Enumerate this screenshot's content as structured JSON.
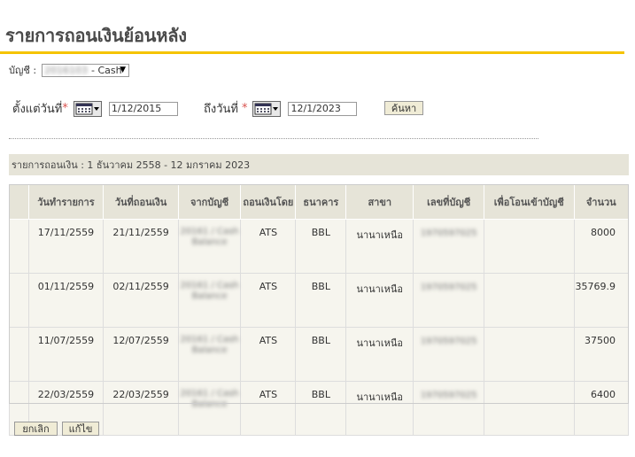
{
  "page": {
    "title": "รายการถอนเงินย้อนหลัง"
  },
  "account": {
    "label": "บัญชี :",
    "selected_number": "2016103",
    "selected_suffix": "- Cash"
  },
  "filter": {
    "from_label": "ตั้งแต่วันที่",
    "to_label": "ถึงวันที่",
    "required_mark": "*",
    "from_value": "1/12/2015",
    "to_value": "12/1/2023",
    "search_label": "ค้นหา"
  },
  "period": {
    "text": "รายการถอนเงิน : 1 ธันวาคม 2558 - 12 มกราคม 2023"
  },
  "table": {
    "columns": [
      "วันทำรายการ",
      "วันที่ถอนเงิน",
      "จากบัญชี",
      "ถอนเงินโดย",
      "ธนาคาร",
      "สาขา",
      "เลขที่บัญชี",
      "เพื่อโอนเข้าบัญชี",
      "จำนวน"
    ],
    "rows": [
      {
        "txn_date": "17/11/2559",
        "withdraw_date": "21/11/2559",
        "from_account": "20161 / Cash Balance",
        "method": "ATS",
        "bank": "BBL",
        "branch": "นานาเหนือ",
        "account_no": "1970597025",
        "transfer_to": "",
        "amount": "8000"
      },
      {
        "txn_date": "01/11/2559",
        "withdraw_date": "02/11/2559",
        "from_account": "20161 / Cash Balance",
        "method": "ATS",
        "bank": "BBL",
        "branch": "นานาเหนือ",
        "account_no": "1970597025",
        "transfer_to": "",
        "amount": "35769.9"
      },
      {
        "txn_date": "11/07/2559",
        "withdraw_date": "12/07/2559",
        "from_account": "20161 / Cash Balance",
        "method": "ATS",
        "bank": "BBL",
        "branch": "นานาเหนือ",
        "account_no": "1970597025",
        "transfer_to": "",
        "amount": "37500"
      },
      {
        "txn_date": "22/03/2559",
        "withdraw_date": "22/03/2559",
        "from_account": "20161 / Cash Balance",
        "method": "ATS",
        "bank": "BBL",
        "branch": "นานาเหนือ",
        "account_no": "1970597025",
        "transfer_to": "",
        "amount": "6400"
      }
    ]
  },
  "actions": {
    "cancel_label": "ยกเลิก",
    "edit_label": "แก้ไข"
  },
  "colors": {
    "accent": "#f5c400",
    "header_bg": "#e6e4d8",
    "row_bg": "#f6f5ee",
    "required": "#d9534f"
  }
}
